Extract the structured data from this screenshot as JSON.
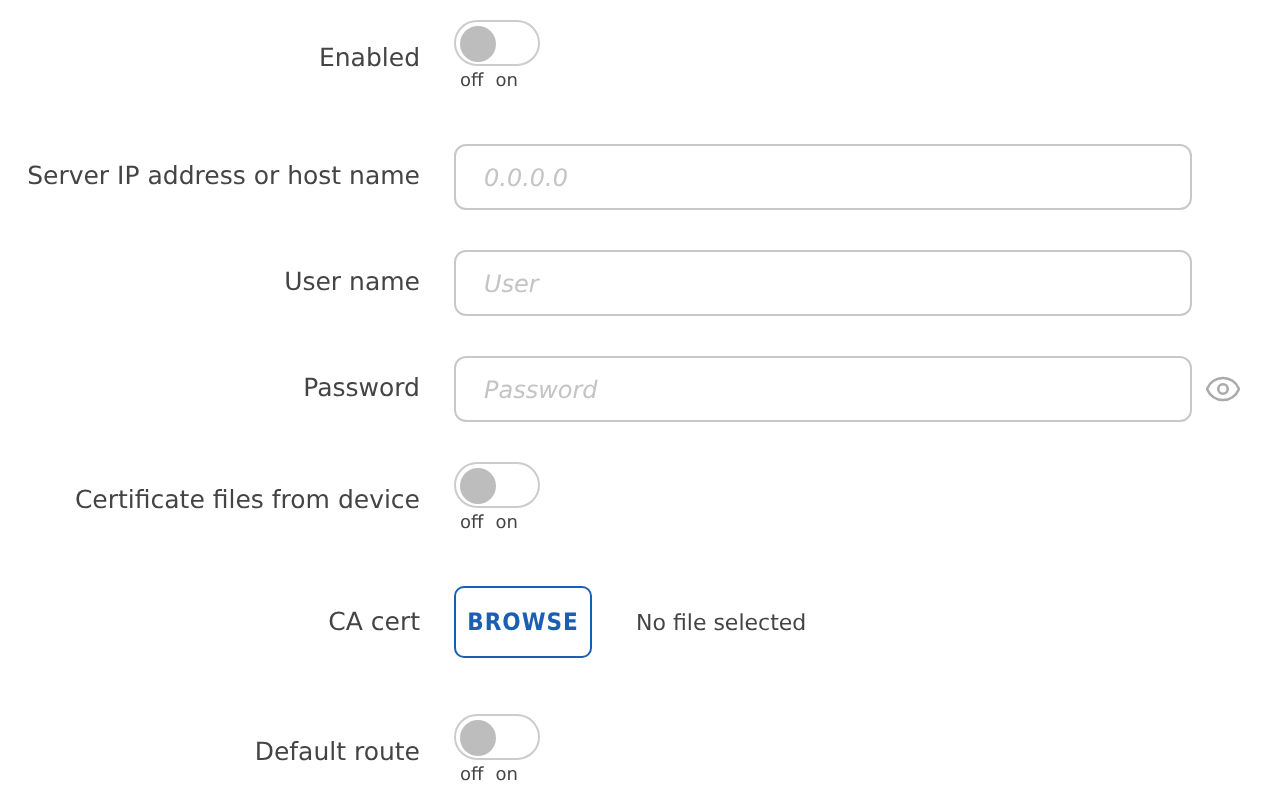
{
  "fields": [
    {
      "kind": "toggle",
      "label": "Enabled",
      "on": false,
      "off_label": "off",
      "on_label": "on"
    },
    {
      "kind": "text",
      "label": "Server IP address or host name",
      "placeholder": "0.0.0.0"
    },
    {
      "kind": "text",
      "label": "User name",
      "placeholder": "User"
    },
    {
      "kind": "password",
      "label": "Password",
      "placeholder": "Password"
    },
    {
      "kind": "toggle",
      "label": "Certificate files from device",
      "on": false,
      "off_label": "off",
      "on_label": "on"
    },
    {
      "kind": "file",
      "label": "CA cert",
      "button": "BROWSE",
      "status": "No file selected"
    },
    {
      "kind": "toggle",
      "label": "Default route",
      "on": false,
      "off_label": "off",
      "on_label": "on"
    }
  ]
}
